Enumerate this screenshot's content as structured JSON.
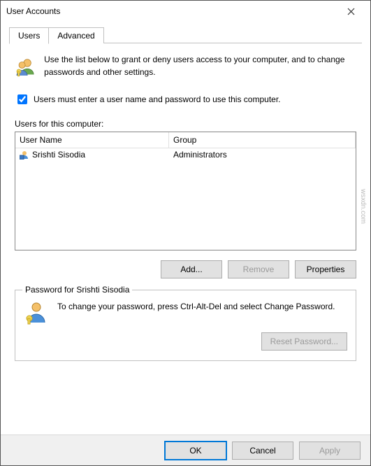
{
  "window": {
    "title": "User Accounts"
  },
  "tabs": {
    "users": "Users",
    "advanced": "Advanced"
  },
  "intro": "Use the list below to grant or deny users access to your computer, and to change passwords and other settings.",
  "checkbox": {
    "label": "Users must enter a user name and password to use this computer.",
    "checked": true
  },
  "list": {
    "label": "Users for this computer:",
    "columns": {
      "username": "User Name",
      "group": "Group"
    },
    "rows": [
      {
        "username": "Srishti Sisodia",
        "group": "Administrators"
      }
    ]
  },
  "buttons": {
    "add": "Add...",
    "remove": "Remove",
    "properties": "Properties",
    "reset_pw": "Reset Password...",
    "ok": "OK",
    "cancel": "Cancel",
    "apply": "Apply"
  },
  "password_box": {
    "legend": "Password for Srishti Sisodia",
    "text": "To change your password, press Ctrl-Alt-Del and select Change Password."
  },
  "watermark": "wsxdn.com"
}
